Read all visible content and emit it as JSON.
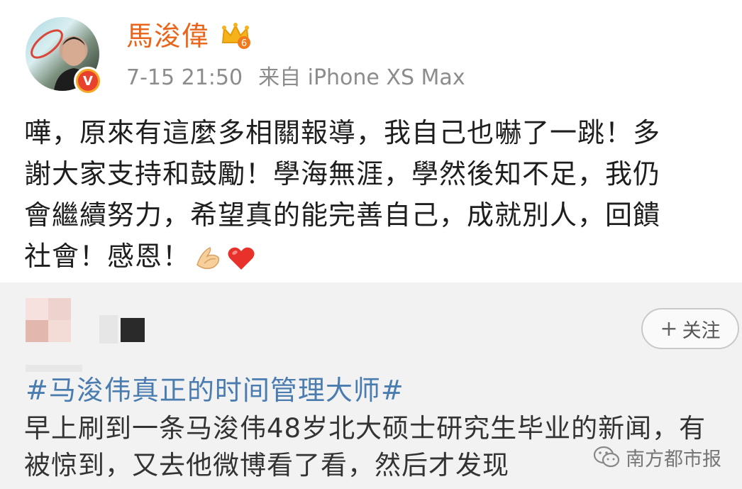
{
  "post": {
    "username": "馬浚偉",
    "member_level": "6",
    "verified_icon": "V",
    "time": "7-15 21:50",
    "source": "来自 iPhone XS Max",
    "lines": [
      "嘩，原來有這麼多相關報導，我自己也嚇了一跳！多",
      "謝大家支持和鼓勵！學海無涯，學然後知不足，我仍",
      "會繼續努力，希望真的能完善自己，成就別人，回饋",
      "社會！感恩！"
    ],
    "emojis": [
      "praying-hands",
      "red-heart"
    ]
  },
  "repost": {
    "follow_label": "关注",
    "follow_plus": "+",
    "hashtag": "#马浚伟真正的时间管理大师#",
    "lines": [
      "早上刷到一条马浚伟48岁北大硕士研究生毕业的新闻，有",
      "被惊到，又去他微博看了看，然后才发现"
    ]
  },
  "watermark": {
    "text": "南方都市报",
    "icon": "wechat-icon"
  },
  "colors": {
    "username": "#e8651b",
    "hashtag": "#4a7cb0",
    "meta": "#8c8c8c"
  }
}
